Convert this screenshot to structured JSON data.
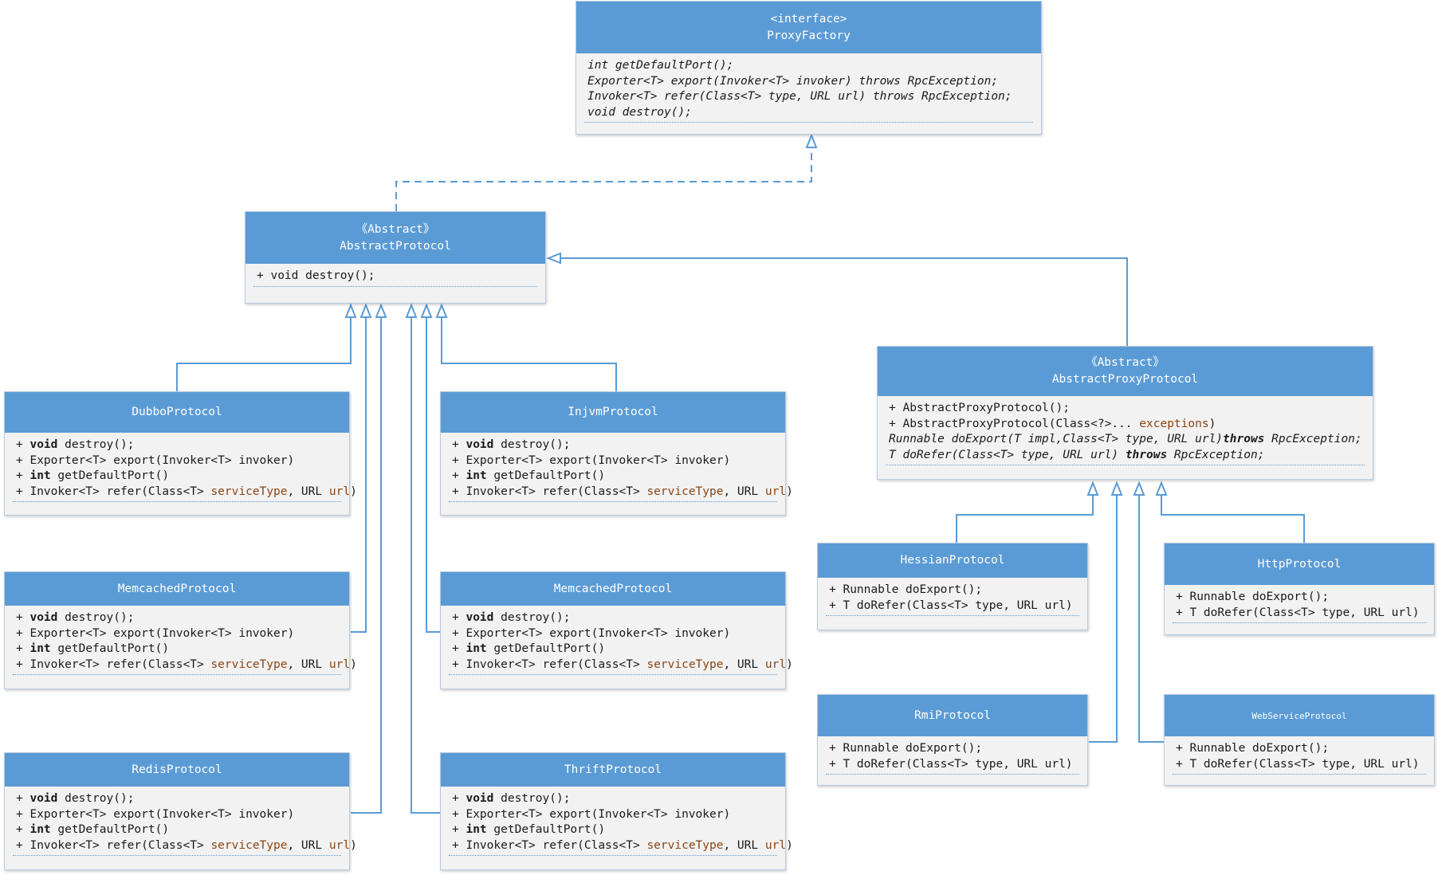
{
  "nodes": {
    "proxyFactory": {
      "stereotype": "<interface>",
      "name": "ProxyFactory",
      "italic": true,
      "methods": [
        [
          {
            "t": "int getDefaultPort();"
          }
        ],
        [
          {
            "t": "Exporter<T> export(Invoker<T> invoker) throws RpcException;"
          }
        ],
        [
          {
            "t": "Invoker<T> refer(Class<T> type, URL url) throws RpcException;"
          }
        ],
        [
          {
            "t": "void destroy();"
          }
        ]
      ]
    },
    "abstractProtocol": {
      "stereotype": "《Abstract》",
      "name": "AbstractProtocol",
      "methods": [
        [
          {
            "t": "+ void destroy();"
          }
        ]
      ]
    },
    "abstractProxyProtocol": {
      "stereotype": "《Abstract》",
      "name": "AbstractProxyProtocol",
      "methods": [
        [
          {
            "t": "+ AbstractProxyProtocol();"
          }
        ],
        [
          {
            "t": "+ AbstractProxyProtocol(Class<?>... "
          },
          {
            "t": "exceptions",
            "c": "pn"
          },
          {
            "t": ")"
          }
        ],
        [
          {
            "t": "Runnable doExport(T impl,Class<T> type, URL url)",
            "c": "it"
          },
          {
            "t": "throws",
            "c": "it kw"
          },
          {
            "t": " RpcException;",
            "c": "it"
          }
        ],
        [
          {
            "t": "T doRefer(Class<T> type, URL url) ",
            "c": "it"
          },
          {
            "t": "throws",
            "c": "it kw"
          },
          {
            "t": " RpcException;",
            "c": "it"
          }
        ]
      ]
    },
    "dubboProtocol": {
      "name": "DubboProtocol",
      "methods": [
        [
          {
            "t": "+ "
          },
          {
            "t": "void",
            "c": "kw"
          },
          {
            "t": " destroy();"
          }
        ],
        [
          {
            "t": "+ Exporter<T> export(Invoker<T> invoker)"
          }
        ],
        [
          {
            "t": "+ "
          },
          {
            "t": "int",
            "c": "kw"
          },
          {
            "t": " getDefaultPort()"
          }
        ],
        [
          {
            "t": "+ Invoker<T> refer(Class<T> "
          },
          {
            "t": "serviceType",
            "c": "pn"
          },
          {
            "t": ", URL "
          },
          {
            "t": "url",
            "c": "pn"
          },
          {
            "t": ")"
          }
        ]
      ]
    },
    "injvmProtocol": {
      "name": "InjvmProtocol",
      "methods": [
        [
          {
            "t": "+ "
          },
          {
            "t": "void",
            "c": "kw"
          },
          {
            "t": " destroy();"
          }
        ],
        [
          {
            "t": "+ Exporter<T> export(Invoker<T> invoker)"
          }
        ],
        [
          {
            "t": "+ "
          },
          {
            "t": "int",
            "c": "kw"
          },
          {
            "t": " getDefaultPort()"
          }
        ],
        [
          {
            "t": "+ Invoker<T> refer(Class<T> "
          },
          {
            "t": "serviceType",
            "c": "pn"
          },
          {
            "t": ", URL "
          },
          {
            "t": "url",
            "c": "pn"
          },
          {
            "t": ")"
          }
        ]
      ]
    },
    "memcachedProtocolLeft": {
      "name": "MemcachedProtocol",
      "methods": [
        [
          {
            "t": "+ "
          },
          {
            "t": "void",
            "c": "kw"
          },
          {
            "t": " destroy();"
          }
        ],
        [
          {
            "t": "+ Exporter<T> export(Invoker<T> invoker)"
          }
        ],
        [
          {
            "t": "+ "
          },
          {
            "t": "int",
            "c": "kw"
          },
          {
            "t": " getDefaultPort()"
          }
        ],
        [
          {
            "t": "+ Invoker<T> refer(Class<T> "
          },
          {
            "t": "serviceType",
            "c": "pn"
          },
          {
            "t": ", URL "
          },
          {
            "t": "url",
            "c": "pn"
          },
          {
            "t": ")"
          }
        ]
      ]
    },
    "memcachedProtocolRight": {
      "name": "MemcachedProtocol",
      "methods": [
        [
          {
            "t": "+ "
          },
          {
            "t": "void",
            "c": "kw"
          },
          {
            "t": " destroy();"
          }
        ],
        [
          {
            "t": "+ Exporter<T> export(Invoker<T> invoker)"
          }
        ],
        [
          {
            "t": "+ "
          },
          {
            "t": "int",
            "c": "kw"
          },
          {
            "t": " getDefaultPort()"
          }
        ],
        [
          {
            "t": "+ Invoker<T> refer(Class<T> "
          },
          {
            "t": "serviceType",
            "c": "pn"
          },
          {
            "t": ", URL "
          },
          {
            "t": "url",
            "c": "pn"
          },
          {
            "t": ")"
          }
        ]
      ]
    },
    "redisProtocol": {
      "name": "RedisProtocol",
      "methods": [
        [
          {
            "t": "+ "
          },
          {
            "t": "void",
            "c": "kw"
          },
          {
            "t": " destroy();"
          }
        ],
        [
          {
            "t": "+ Exporter<T> export(Invoker<T> invoker)"
          }
        ],
        [
          {
            "t": "+ "
          },
          {
            "t": "int",
            "c": "kw"
          },
          {
            "t": " getDefaultPort()"
          }
        ],
        [
          {
            "t": "+ Invoker<T> refer(Class<T> "
          },
          {
            "t": "serviceType",
            "c": "pn"
          },
          {
            "t": ", URL "
          },
          {
            "t": "url",
            "c": "pn"
          },
          {
            "t": ")"
          }
        ]
      ]
    },
    "thriftProtocol": {
      "name": "ThriftProtocol",
      "methods": [
        [
          {
            "t": "+ "
          },
          {
            "t": "void",
            "c": "kw"
          },
          {
            "t": " destroy();"
          }
        ],
        [
          {
            "t": "+ Exporter<T> export(Invoker<T> invoker)"
          }
        ],
        [
          {
            "t": "+ "
          },
          {
            "t": "int",
            "c": "kw"
          },
          {
            "t": " getDefaultPort()"
          }
        ],
        [
          {
            "t": "+ Invoker<T> refer(Class<T> "
          },
          {
            "t": "serviceType",
            "c": "pn"
          },
          {
            "t": ", URL "
          },
          {
            "t": "url",
            "c": "pn"
          },
          {
            "t": ")"
          }
        ]
      ]
    },
    "hessianProtocol": {
      "name": "HessianProtocol",
      "methods": [
        [
          {
            "t": "+ Runnable doExport();"
          }
        ],
        [
          {
            "t": "+ T doRefer(Class<T> type, URL url)"
          }
        ]
      ]
    },
    "httpProtocol": {
      "name": "HttpProtocol",
      "methods": [
        [
          {
            "t": "+ Runnable doExport();"
          }
        ],
        [
          {
            "t": "+ T doRefer(Class<T> type, URL url)"
          }
        ]
      ]
    },
    "rmiProtocol": {
      "name": "RmiProtocol",
      "methods": [
        [
          {
            "t": "+ Runnable doExport();"
          }
        ],
        [
          {
            "t": "+ T doRefer(Class<T> type, URL url)"
          }
        ]
      ]
    },
    "webServiceProtocol": {
      "name": "WebServiceProtocol",
      "methods": [
        [
          {
            "t": "+ Runnable doExport();"
          }
        ],
        [
          {
            "t": "+ T doRefer(Class<T> type, URL url)"
          }
        ]
      ]
    }
  },
  "relations": [
    {
      "from": "abstractProtocol",
      "to": "proxyFactory",
      "kind": "realization"
    },
    {
      "from": "abstractProxyProtocol",
      "to": "abstractProtocol",
      "kind": "generalization"
    },
    {
      "from": "dubboProtocol",
      "to": "abstractProtocol",
      "kind": "generalization"
    },
    {
      "from": "memcachedProtocolLeft",
      "to": "abstractProtocol",
      "kind": "generalization"
    },
    {
      "from": "redisProtocol",
      "to": "abstractProtocol",
      "kind": "generalization"
    },
    {
      "from": "thriftProtocol",
      "to": "abstractProtocol",
      "kind": "generalization"
    },
    {
      "from": "memcachedProtocolRight",
      "to": "abstractProtocol",
      "kind": "generalization"
    },
    {
      "from": "injvmProtocol",
      "to": "abstractProtocol",
      "kind": "generalization"
    },
    {
      "from": "hessianProtocol",
      "to": "abstractProxyProtocol",
      "kind": "generalization"
    },
    {
      "from": "rmiProtocol",
      "to": "abstractProxyProtocol",
      "kind": "generalization"
    },
    {
      "from": "webServiceProtocol",
      "to": "abstractProxyProtocol",
      "kind": "generalization"
    },
    {
      "from": "httpProtocol",
      "to": "abstractProxyProtocol",
      "kind": "generalization"
    }
  ],
  "colors": {
    "header": "#5b9bd5",
    "body": "#f2f2f2",
    "connector": "#5b9bd5",
    "param": "#8b4513"
  }
}
